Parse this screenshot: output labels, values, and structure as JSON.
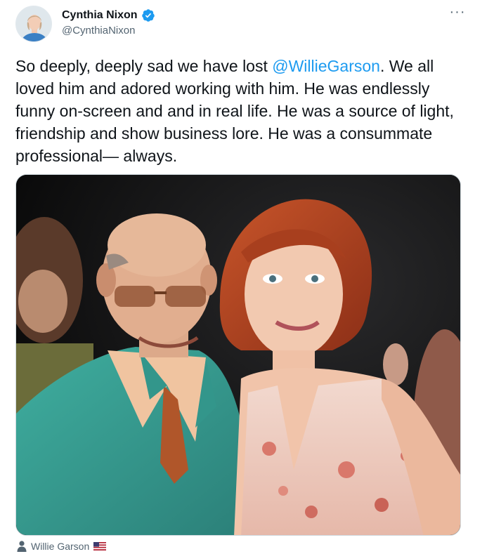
{
  "author": {
    "display_name": "Cynthia Nixon",
    "handle": "@CynthiaNixon",
    "verified": true,
    "avatar_icon": "profile-photo"
  },
  "more_icon": "more-horizontal-icon",
  "more_label": "···",
  "tweet": {
    "text_before": "So deeply, deeply sad we have lost ",
    "mention": "@WillieGarson",
    "text_after": ". We all loved him and adored working with him. He was endlessly funny on-screen and and in real life. He was a source of light, friendship and show business lore. He was a consummate professional— always."
  },
  "media": {
    "type": "photo"
  },
  "tagged": {
    "name": "Willie Garson",
    "icon": "person-icon",
    "flag": "us-flag-icon"
  },
  "colors": {
    "link": "#1d9bf0",
    "secondary_text": "#536471",
    "verified": "#1d9bf0"
  }
}
